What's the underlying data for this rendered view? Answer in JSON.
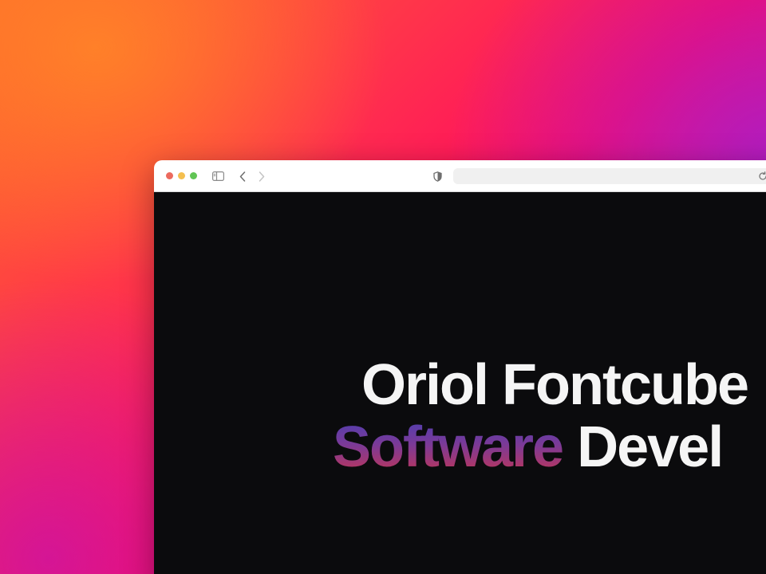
{
  "colors": {
    "traffic_light_close": "#ec6a5e",
    "traffic_light_minimize": "#f4bf4f",
    "traffic_light_zoom": "#61c554",
    "page_background": "#0b0b0d",
    "hero_text": "#f5f5f5",
    "gradient_start": "#4a3fb2",
    "gradient_end": "#c8354f"
  },
  "browser": {
    "toolbar_icons": [
      "sidebar-icon",
      "back-icon",
      "forward-icon",
      "shield-icon",
      "reload-icon"
    ],
    "address_bar_value": ""
  },
  "hero": {
    "line1": "Oriol Fontcube",
    "line2_highlight": "Software",
    "line2_rest": "Devel"
  }
}
